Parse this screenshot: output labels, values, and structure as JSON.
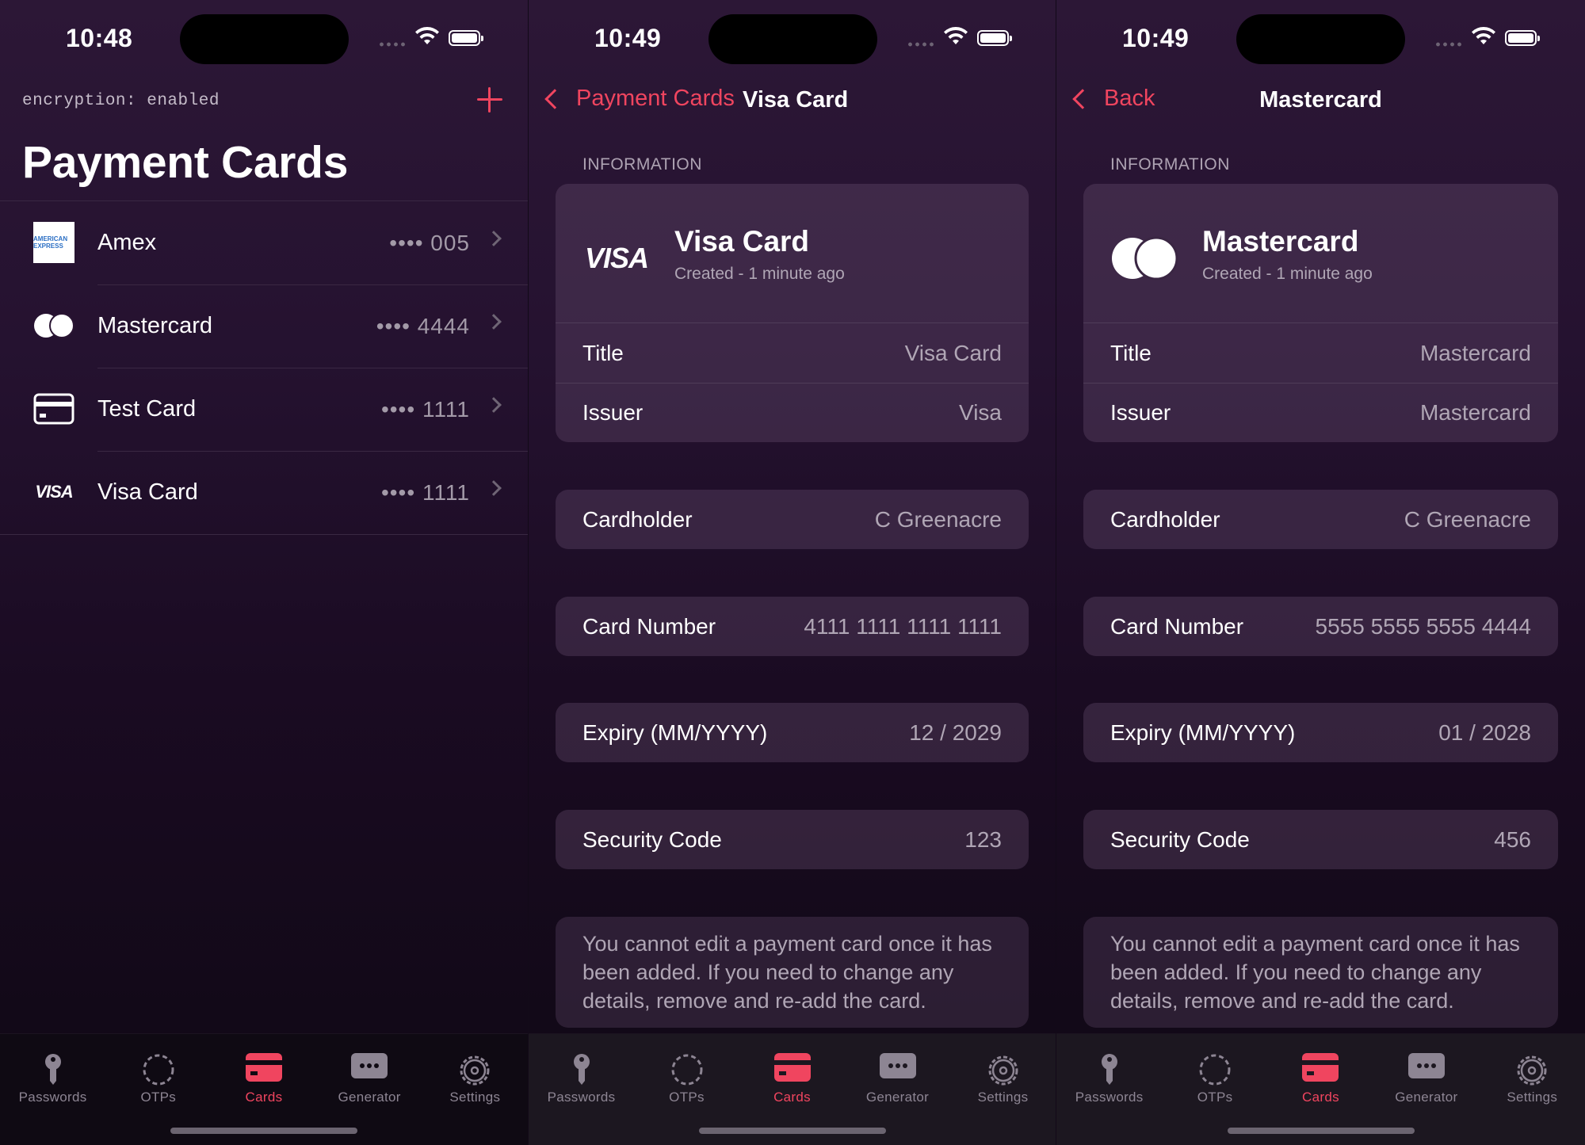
{
  "accent": "#f0455f",
  "screens": [
    {
      "time": "10:48",
      "encryption": "encryption: enabled",
      "title": "Payment Cards",
      "cards": [
        {
          "name": "Amex",
          "number": "•••• 005",
          "icon": "amex-logo-icon",
          "amex_logo": "AMERICAN EXPRESS"
        },
        {
          "name": "Mastercard",
          "number": "•••• 4444",
          "icon": "mastercard-logo-icon"
        },
        {
          "name": "Test Card",
          "number": "•••• 1111",
          "icon": "credit-card-icon"
        },
        {
          "name": "Visa Card",
          "number": "•••• 1111",
          "icon": "visa-logo-icon",
          "visa_logo": "VISA"
        }
      ]
    },
    {
      "time": "10:49",
      "back_label": "Payment Cards",
      "nav_title": "Visa Card",
      "section": "INFORMATION",
      "header_title": "Visa Card",
      "header_sub": "Created - 1 minute ago",
      "logo": "VISA",
      "title_label": "Title",
      "title_value": "Visa Card",
      "issuer_label": "Issuer",
      "issuer_value": "Visa",
      "cardholder_label": "Cardholder",
      "cardholder_value": "C Greenacre",
      "number_label": "Card Number",
      "number_value": "4111 1111 1111 1111",
      "expiry_label": "Expiry (MM/YYYY)",
      "expiry_value": "12 / 2029",
      "cvc_label": "Security Code",
      "cvc_value": "123",
      "note": "You cannot edit a payment card once it has been added. If you need to change any details, remove and re-add the card."
    },
    {
      "time": "10:49",
      "back_label": "Back",
      "nav_title": "Mastercard",
      "section": "INFORMATION",
      "header_title": "Mastercard",
      "header_sub": "Created - 1 minute ago",
      "title_label": "Title",
      "title_value": "Mastercard",
      "issuer_label": "Issuer",
      "issuer_value": "Mastercard",
      "cardholder_label": "Cardholder",
      "cardholder_value": "C Greenacre",
      "number_label": "Card Number",
      "number_value": "5555 5555 5555 4444",
      "expiry_label": "Expiry (MM/YYYY)",
      "expiry_value": "01 / 2028",
      "cvc_label": "Security Code",
      "cvc_value": "456",
      "note": "You cannot edit a payment card once it has been added. If you need to change any details, remove and re-add the card."
    }
  ],
  "tabs": [
    {
      "label": "Passwords",
      "icon": "key-icon"
    },
    {
      "label": "OTPs",
      "icon": "otp-timer-icon"
    },
    {
      "label": "Cards",
      "icon": "credit-card-icon",
      "active": true
    },
    {
      "label": "Generator",
      "icon": "generator-icon"
    },
    {
      "label": "Settings",
      "icon": "gear-icon"
    }
  ]
}
